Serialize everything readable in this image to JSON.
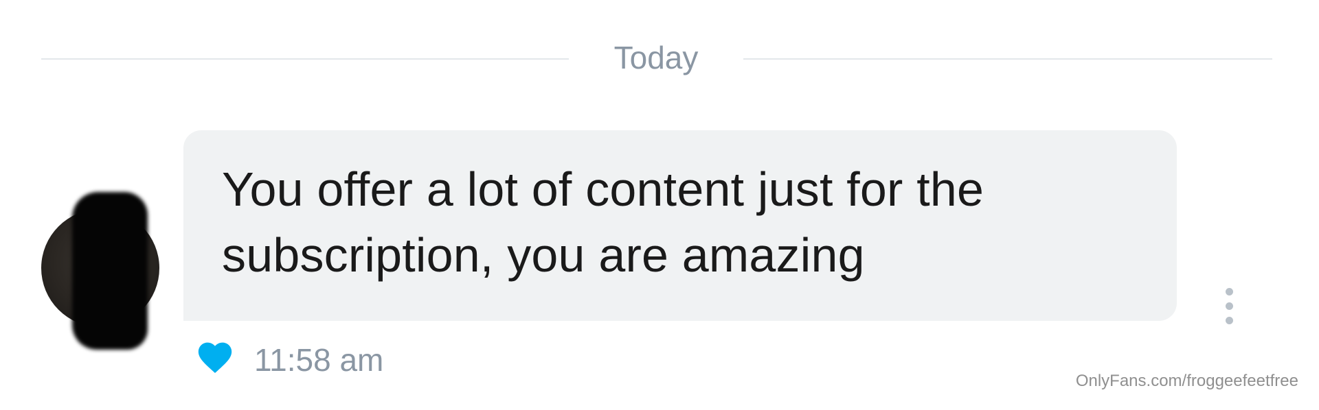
{
  "chat": {
    "date_divider": "Today",
    "message": {
      "text": "You offer a lot of content just for the subscription, you are amazing",
      "time": "11:58 am",
      "liked": true
    }
  },
  "icons": {
    "like": "heart-icon",
    "more": "more-vertical-icon",
    "avatar": "avatar-obscured"
  },
  "watermark": "OnlyFans.com/froggeefeetfree",
  "colors": {
    "background": "#ffffff",
    "bubble": "#f0f2f3",
    "muted_text": "#8a96a3",
    "like_blue": "#00aff0",
    "dots": "#b9c1c9"
  }
}
